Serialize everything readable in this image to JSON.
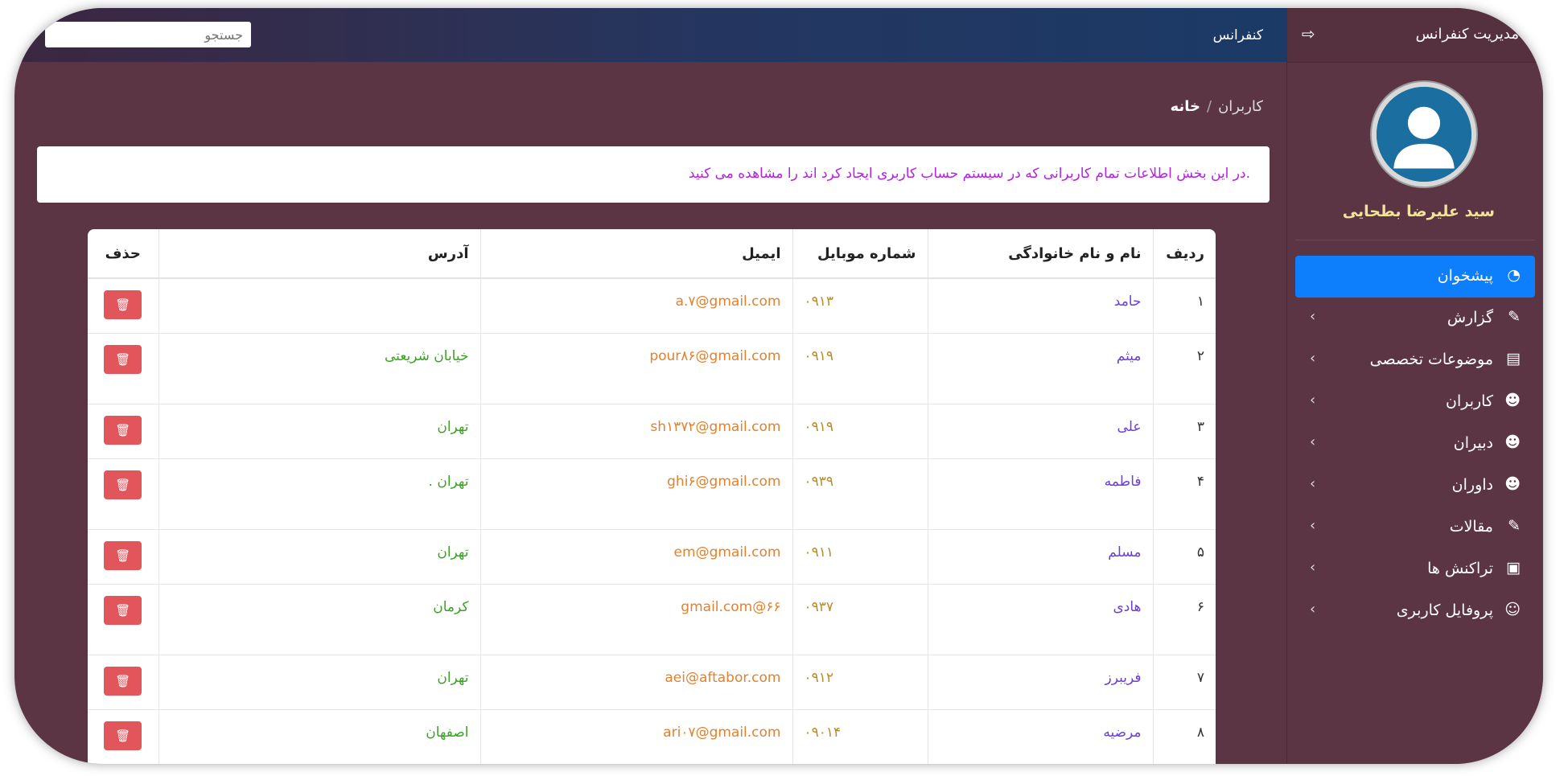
{
  "sidebar": {
    "title": "مدیریت کنفرانس",
    "user_name": "سید علیرضا بطحایی",
    "items": [
      {
        "label": "پیشخوان",
        "icon": "dashboard-icon",
        "active": true
      },
      {
        "label": "گزارش",
        "icon": "edit-icon"
      },
      {
        "label": "موضوعات تخصصی",
        "icon": "archive-icon"
      },
      {
        "label": "کاربران",
        "icon": "users-icon"
      },
      {
        "label": "دبیران",
        "icon": "users-icon"
      },
      {
        "label": "داوران",
        "icon": "users-icon"
      },
      {
        "label": "مقالات",
        "icon": "edit-icon"
      },
      {
        "label": "تراکنش ها",
        "icon": "money-icon"
      },
      {
        "label": "پروفایل کاربری",
        "icon": "user-icon"
      }
    ]
  },
  "navbar": {
    "brand": "کنفرانس",
    "search_placeholder": "جستجو"
  },
  "breadcrumb": {
    "home": "خانه",
    "separator": "/",
    "current": "کاربران"
  },
  "info_text": "در این بخش اطلاعات تمام کاربرانی که در سیستم حساب کاربری ایجاد کرد اند را مشاهده می کنید.",
  "table": {
    "headers": [
      "ردیف",
      "نام و نام خانوادگی",
      "شماره موبایل",
      "ایمیل",
      "آدرس",
      "حذف"
    ],
    "rows": [
      {
        "idx": "۱",
        "name": "حامد",
        "mobile": "۰۹۱۳",
        "email": "a.۷@gmail.com",
        "address": ""
      },
      {
        "idx": "۲",
        "name": "میثم",
        "mobile": "۰۹۱۹",
        "email": "pour۸۶@gmail.com",
        "address": "خیابان شریعتی"
      },
      {
        "idx": "۳",
        "name": "علی",
        "mobile": "۰۹۱۹",
        "email": "sh۱۳۷۲@gmail.com",
        "address": "تهران"
      },
      {
        "idx": "۴",
        "name": "فاطمه",
        "mobile": "۰۹۳۹",
        "email": "ghi۶@gmail.com",
        "address": "تهران ."
      },
      {
        "idx": "۵",
        "name": "مسلم",
        "mobile": "۰۹۱۱",
        "email": "em@gmail.com",
        "address": "تهران"
      },
      {
        "idx": "۶",
        "name": "هادی",
        "mobile": "۰۹۳۷",
        "email": "۶۶@gmail.com",
        "address": "کرمان"
      },
      {
        "idx": "۷",
        "name": "فریبرز",
        "mobile": "۰۹۱۲",
        "email": "aei@aftabor.com",
        "address": "تهران"
      },
      {
        "idx": "۸",
        "name": "مرضیه",
        "mobile": "۰۹۰۱۴",
        "email": "ari۰۷@gmail.com",
        "address": "اصفهان"
      }
    ]
  },
  "colors": {
    "background": "#5c3544",
    "active_menu": "#0d7efc",
    "delete_button": "#e2555a",
    "name_text": "#6a3fd7",
    "email_text": "#e0822f",
    "address_text": "#39a322",
    "info_text": "#b51fe6"
  }
}
